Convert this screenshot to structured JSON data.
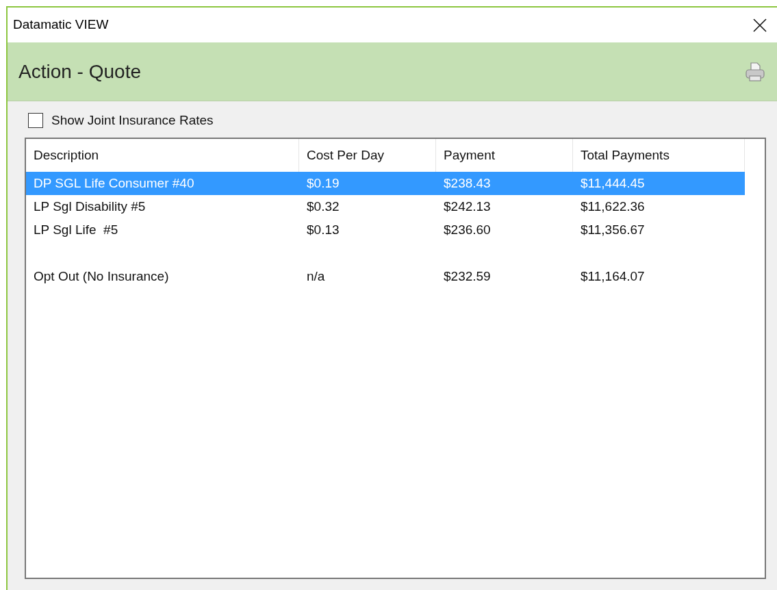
{
  "window": {
    "title": "Datamatic VIEW"
  },
  "header": {
    "title": "Action - Quote"
  },
  "joint_rates": {
    "label": "Show Joint Insurance Rates",
    "checked": false
  },
  "table": {
    "columns": [
      "Description",
      "Cost Per Day",
      "Payment",
      "Total Payments"
    ],
    "rows": [
      {
        "kind": "plan",
        "selected": true,
        "cells": [
          "DP SGL Life Consumer #40",
          "$0.19",
          "$238.43",
          "$11,444.45"
        ]
      },
      {
        "kind": "plan",
        "selected": false,
        "cells": [
          "LP Sgl Disability #5",
          "$0.32",
          "$242.13",
          "$11,622.36"
        ]
      },
      {
        "kind": "plan",
        "selected": false,
        "cells": [
          "LP Sgl Life  #5",
          "$0.13",
          "$236.60",
          "$11,356.67"
        ]
      },
      {
        "kind": "opt_out",
        "selected": false,
        "cells": [
          "Opt Out (No Insurance)",
          "n/a",
          "$232.59",
          "$11,164.07"
        ]
      }
    ]
  }
}
